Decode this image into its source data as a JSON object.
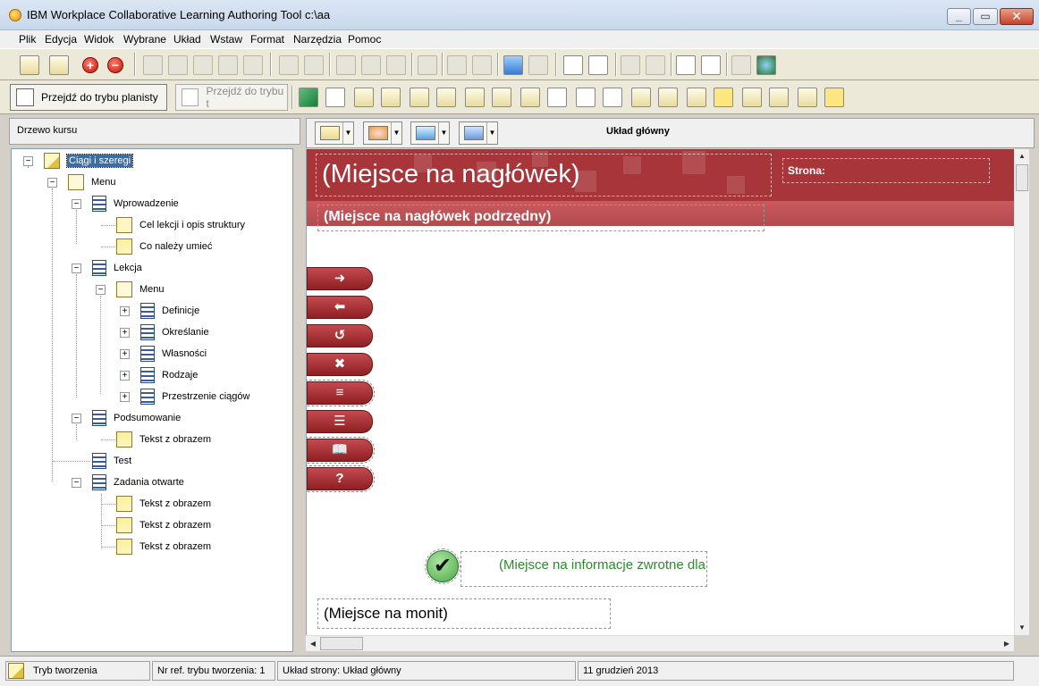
{
  "window": {
    "title": "IBM Workplace Collaborative Learning Authoring Tool   c:\\aa"
  },
  "menu": [
    {
      "label": "Plik"
    },
    {
      "label": "Edycja"
    },
    {
      "label": "Widok"
    },
    {
      "label": "Wybrane"
    },
    {
      "label": "Układ"
    },
    {
      "label": "Wstaw"
    },
    {
      "label": "Format"
    },
    {
      "label": "Narzędzia"
    },
    {
      "label": "Pomoc"
    }
  ],
  "toolbar2": {
    "planner_btn": "Przejdź do trybu planisty",
    "disabled_btn": "Przejdź do trybu t"
  },
  "tree": {
    "header": "Drzewo kursu",
    "nodes": [
      {
        "label": "Ciągi i szeregi"
      },
      {
        "label": "Menu"
      },
      {
        "label": "Wprowadzenie"
      },
      {
        "label": "Cel lekcji i opis struktury"
      },
      {
        "label": "Co należy umieć"
      },
      {
        "label": "Lekcja"
      },
      {
        "label": "Menu"
      },
      {
        "label": "Definicje"
      },
      {
        "label": "Określanie"
      },
      {
        "label": "Własności"
      },
      {
        "label": "Rodzaje"
      },
      {
        "label": "Przestrzenie ciągów"
      },
      {
        "label": "Podsumowanie"
      },
      {
        "label": "Tekst z obrazem"
      },
      {
        "label": "Test"
      },
      {
        "label": "Zadania otwarte"
      },
      {
        "label": "Tekst z obrazem"
      },
      {
        "label": "Tekst z obrazem"
      },
      {
        "label": "Tekst z obrazem"
      }
    ]
  },
  "editor": {
    "layout_title": "Układ główny",
    "header_placeholder": "(Miejsce na nagłówek)",
    "page_label": "Strona:",
    "subheader_placeholder": "(Miejsce na nagłówek podrzędny)",
    "feedback_placeholder": "(Miejsce na informacje zwrotne dla",
    "prompt_placeholder": "(Miejsce na monit)",
    "colors": {
      "banner": "#a8353a",
      "subbar": "#c95a5e",
      "feedback_text": "#2e8b2e"
    }
  },
  "nav_buttons": [
    {
      "icon": "arrow-right-icon",
      "glyph": "➜"
    },
    {
      "icon": "arrow-left-icon",
      "glyph": "⬅"
    },
    {
      "icon": "restart-icon",
      "glyph": "↺"
    },
    {
      "icon": "close-x-icon",
      "glyph": "✖"
    },
    {
      "icon": "menu-lines-icon",
      "glyph": "≡"
    },
    {
      "icon": "list-icon",
      "glyph": "☰"
    },
    {
      "icon": "book-icon",
      "glyph": "📖"
    },
    {
      "icon": "help-icon",
      "glyph": "?"
    }
  ],
  "statusbar": {
    "mode": "Tryb tworzenia",
    "ref": "Nr ref. trybu tworzenia: 1",
    "layout": "Układ strony: Układ główny",
    "date": "11 grudzień 2013"
  }
}
